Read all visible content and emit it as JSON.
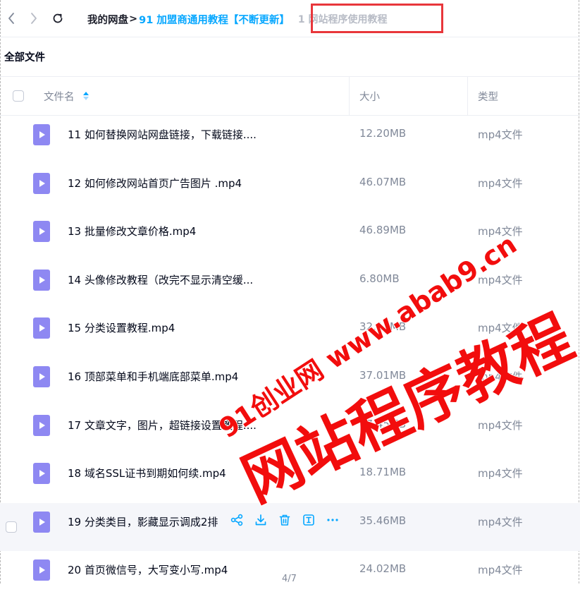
{
  "nav": {
    "back_icon": "chevron-left-icon",
    "forward_icon": "chevron-right-icon",
    "refresh_icon": "refresh-icon"
  },
  "breadcrumb": {
    "root": "我的网盘",
    "separator": ">",
    "middle": "91 加盟商通用教程【不断更新】",
    "current": "1 网站程序使用教程"
  },
  "section_title": "全部文件",
  "table": {
    "col_name": "文件名",
    "col_size": "大小",
    "col_type": "类型",
    "rows": [
      {
        "name": "11 如何替换网站网盘链接，下载链接....",
        "size": "12.20MB",
        "type": "mp4文件"
      },
      {
        "name": "12 如何修改网站首页广告图片 .mp4",
        "size": "46.07MB",
        "type": "mp4文件"
      },
      {
        "name": "13 批量修改文章价格.mp4",
        "size": "46.89MB",
        "type": "mp4文件"
      },
      {
        "name": "14 头像修改教程（改完不显示清空缓...",
        "size": "6.80MB",
        "type": "mp4文件"
      },
      {
        "name": "15 分类设置教程.mp4",
        "size": "32.12MB",
        "type": "mp4文件"
      },
      {
        "name": "16 顶部菜单和手机端底部菜单.mp4",
        "size": "37.01MB",
        "type": "mp4文件"
      },
      {
        "name": "17 文章文字，图片，超链接设置教程....",
        "size": "27.45MB",
        "type": "mp4文件"
      },
      {
        "name": "18 域名SSL证书到期如何续.mp4",
        "size": "18.71MB",
        "type": "mp4文件"
      },
      {
        "name": "19 分类类目，影藏显示调成2排",
        "size": "35.46MB",
        "type": "mp4文件"
      },
      {
        "name": "20 首页微信号，大写变小写.mp4",
        "size": "24.02MB",
        "type": "mp4文件"
      }
    ]
  },
  "row_actions": [
    "share-icon",
    "download-icon",
    "delete-icon",
    "rename-icon",
    "more-icon"
  ],
  "page_indicator": "4/7",
  "watermark": {
    "line1": "91创业网 www.abab9.cn",
    "line2": "网站程序教程",
    "color": "#f20d0d"
  },
  "colors": {
    "accent": "#06a7ff",
    "file_icon": "#8e88f2",
    "highlight_box": "#e8363b"
  }
}
